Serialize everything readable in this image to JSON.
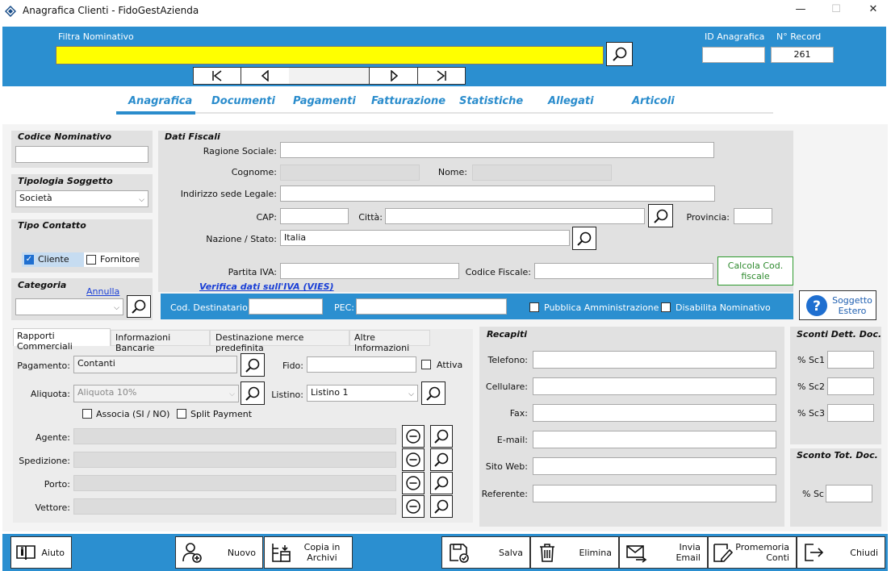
{
  "window": {
    "title": "Anagrafica Clienti - FidoGestAzienda",
    "minimize": "—",
    "maximize": "☐",
    "close": "✕"
  },
  "header": {
    "filter_label": "Filtra Nominativo",
    "filter_value": "",
    "id_label": "ID Anagrafica",
    "id_value": "",
    "record_label": "N° Record",
    "record_value": "261"
  },
  "tabs": [
    "Anagrafica",
    "Documenti",
    "Pagamenti",
    "Fatturazione",
    "Statistiche",
    "Allegati",
    "Articoli"
  ],
  "left": {
    "codice_title": "Codice Nominativo",
    "codice_value": "",
    "tipologia_title": "Tipologia Soggetto",
    "tipologia_value": "Società",
    "tipo_contatto_title": "Tipo Contatto",
    "cliente": "Cliente",
    "fornitore": "Fornitore",
    "categoria_title": "Categoria",
    "annulla": "Annulla",
    "categoria_value": ""
  },
  "fiscali": {
    "title": "Dati Fiscali",
    "ragione_label": "Ragione Sociale:",
    "cognome_label": "Cognome:",
    "nome_label": "Nome:",
    "indirizzo_label": "Indirizzo sede Legale:",
    "cap_label": "CAP:",
    "citta_label": "Città:",
    "provincia_label": "Provincia:",
    "nazione_label": "Nazione / Stato:",
    "nazione_value": "Italia",
    "piva_label": "Partita IVA:",
    "cf_label": "Codice Fiscale:",
    "calcola": "Calcola Cod. fiscale",
    "vies": "Verifica dati sull'IVA (VIES)",
    "cod_dest_label": "Cod. Destinatario:",
    "pec_label": "PEC:",
    "pa_label": "Pubblica Amministrazione",
    "disabilita_label": "Disabilita Nominativo",
    "estero": "Soggetto Estero"
  },
  "rapporti": {
    "tabs": [
      "Rapporti Commerciali",
      "Informazioni Bancarie",
      "Destinazione merce predefinita",
      "Altre Informazioni"
    ],
    "pagamento_label": "Pagamento:",
    "pagamento_value": "Contanti",
    "fido_label": "Fido:",
    "attiva_label": "Attiva",
    "aliquota_label": "Aliquota:",
    "aliquota_value": "Aliquota 10%",
    "listino_label": "Listino:",
    "listino_value": "Listino 1",
    "associa_label": "Associa (SI / NO)",
    "split_label": "Split Payment",
    "agente_label": "Agente:",
    "spedizione_label": "Spedizione:",
    "porto_label": "Porto:",
    "vettore_label": "Vettore:"
  },
  "recapiti": {
    "title": "Recapiti",
    "telefono": "Telefono:",
    "cellulare": "Cellulare:",
    "fax": "Fax:",
    "email": "E-mail:",
    "sito": "Sito Web:",
    "referente": "Referente:"
  },
  "sconti": {
    "title": "Sconti Dett. Doc.",
    "sc1": "% Sc1",
    "sc2": "% Sc2",
    "sc3": "% Sc3",
    "tot_title": "Sconto Tot. Doc.",
    "sc": "% Sc"
  },
  "buttons": {
    "aiuto": "Aiuto",
    "nuovo": "Nuovo",
    "copia": "Copia in Archivi",
    "salva": "Salva",
    "elimina": "Elimina",
    "invia": "Invia Email",
    "promemoria": "Promemoria Conti",
    "chiudi": "Chiudi"
  }
}
